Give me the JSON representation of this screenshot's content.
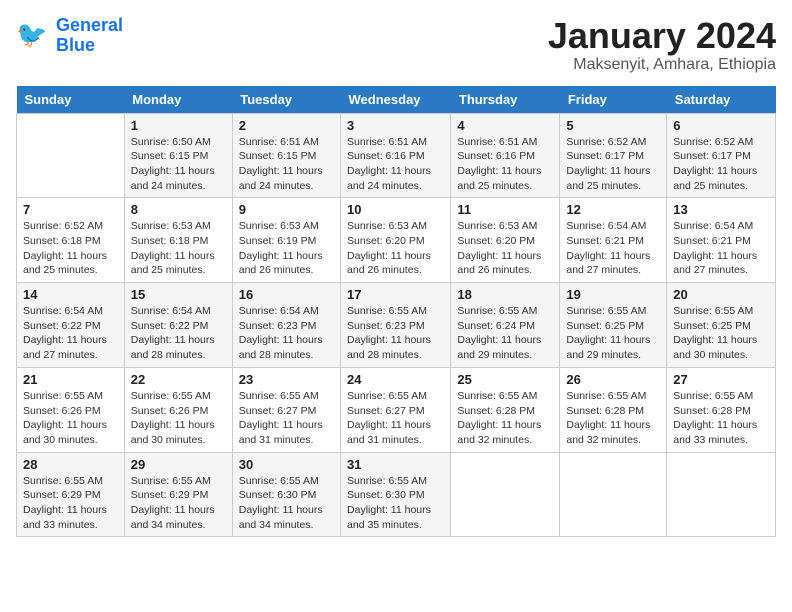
{
  "logo": {
    "line1": "General",
    "line2": "Blue"
  },
  "header": {
    "month": "January 2024",
    "location": "Maksenyit, Amhara, Ethiopia"
  },
  "weekdays": [
    "Sunday",
    "Monday",
    "Tuesday",
    "Wednesday",
    "Thursday",
    "Friday",
    "Saturday"
  ],
  "weeks": [
    [
      {
        "day": "",
        "sunrise": "",
        "sunset": "",
        "daylight": ""
      },
      {
        "day": "1",
        "sunrise": "6:50 AM",
        "sunset": "6:15 PM",
        "daylight": "11 hours and 24 minutes."
      },
      {
        "day": "2",
        "sunrise": "6:51 AM",
        "sunset": "6:15 PM",
        "daylight": "11 hours and 24 minutes."
      },
      {
        "day": "3",
        "sunrise": "6:51 AM",
        "sunset": "6:16 PM",
        "daylight": "11 hours and 24 minutes."
      },
      {
        "day": "4",
        "sunrise": "6:51 AM",
        "sunset": "6:16 PM",
        "daylight": "11 hours and 25 minutes."
      },
      {
        "day": "5",
        "sunrise": "6:52 AM",
        "sunset": "6:17 PM",
        "daylight": "11 hours and 25 minutes."
      },
      {
        "day": "6",
        "sunrise": "6:52 AM",
        "sunset": "6:17 PM",
        "daylight": "11 hours and 25 minutes."
      }
    ],
    [
      {
        "day": "7",
        "sunrise": "6:52 AM",
        "sunset": "6:18 PM",
        "daylight": "11 hours and 25 minutes."
      },
      {
        "day": "8",
        "sunrise": "6:53 AM",
        "sunset": "6:18 PM",
        "daylight": "11 hours and 25 minutes."
      },
      {
        "day": "9",
        "sunrise": "6:53 AM",
        "sunset": "6:19 PM",
        "daylight": "11 hours and 26 minutes."
      },
      {
        "day": "10",
        "sunrise": "6:53 AM",
        "sunset": "6:20 PM",
        "daylight": "11 hours and 26 minutes."
      },
      {
        "day": "11",
        "sunrise": "6:53 AM",
        "sunset": "6:20 PM",
        "daylight": "11 hours and 26 minutes."
      },
      {
        "day": "12",
        "sunrise": "6:54 AM",
        "sunset": "6:21 PM",
        "daylight": "11 hours and 27 minutes."
      },
      {
        "day": "13",
        "sunrise": "6:54 AM",
        "sunset": "6:21 PM",
        "daylight": "11 hours and 27 minutes."
      }
    ],
    [
      {
        "day": "14",
        "sunrise": "6:54 AM",
        "sunset": "6:22 PM",
        "daylight": "11 hours and 27 minutes."
      },
      {
        "day": "15",
        "sunrise": "6:54 AM",
        "sunset": "6:22 PM",
        "daylight": "11 hours and 28 minutes."
      },
      {
        "day": "16",
        "sunrise": "6:54 AM",
        "sunset": "6:23 PM",
        "daylight": "11 hours and 28 minutes."
      },
      {
        "day": "17",
        "sunrise": "6:55 AM",
        "sunset": "6:23 PM",
        "daylight": "11 hours and 28 minutes."
      },
      {
        "day": "18",
        "sunrise": "6:55 AM",
        "sunset": "6:24 PM",
        "daylight": "11 hours and 29 minutes."
      },
      {
        "day": "19",
        "sunrise": "6:55 AM",
        "sunset": "6:25 PM",
        "daylight": "11 hours and 29 minutes."
      },
      {
        "day": "20",
        "sunrise": "6:55 AM",
        "sunset": "6:25 PM",
        "daylight": "11 hours and 30 minutes."
      }
    ],
    [
      {
        "day": "21",
        "sunrise": "6:55 AM",
        "sunset": "6:26 PM",
        "daylight": "11 hours and 30 minutes."
      },
      {
        "day": "22",
        "sunrise": "6:55 AM",
        "sunset": "6:26 PM",
        "daylight": "11 hours and 30 minutes."
      },
      {
        "day": "23",
        "sunrise": "6:55 AM",
        "sunset": "6:27 PM",
        "daylight": "11 hours and 31 minutes."
      },
      {
        "day": "24",
        "sunrise": "6:55 AM",
        "sunset": "6:27 PM",
        "daylight": "11 hours and 31 minutes."
      },
      {
        "day": "25",
        "sunrise": "6:55 AM",
        "sunset": "6:28 PM",
        "daylight": "11 hours and 32 minutes."
      },
      {
        "day": "26",
        "sunrise": "6:55 AM",
        "sunset": "6:28 PM",
        "daylight": "11 hours and 32 minutes."
      },
      {
        "day": "27",
        "sunrise": "6:55 AM",
        "sunset": "6:28 PM",
        "daylight": "11 hours and 33 minutes."
      }
    ],
    [
      {
        "day": "28",
        "sunrise": "6:55 AM",
        "sunset": "6:29 PM",
        "daylight": "11 hours and 33 minutes."
      },
      {
        "day": "29",
        "sunrise": "6:55 AM",
        "sunset": "6:29 PM",
        "daylight": "11 hours and 34 minutes."
      },
      {
        "day": "30",
        "sunrise": "6:55 AM",
        "sunset": "6:30 PM",
        "daylight": "11 hours and 34 minutes."
      },
      {
        "day": "31",
        "sunrise": "6:55 AM",
        "sunset": "6:30 PM",
        "daylight": "11 hours and 35 minutes."
      },
      {
        "day": "",
        "sunrise": "",
        "sunset": "",
        "daylight": ""
      },
      {
        "day": "",
        "sunrise": "",
        "sunset": "",
        "daylight": ""
      },
      {
        "day": "",
        "sunrise": "",
        "sunset": "",
        "daylight": ""
      }
    ]
  ],
  "labels": {
    "sunrise": "Sunrise:",
    "sunset": "Sunset:",
    "daylight": "Daylight:"
  }
}
